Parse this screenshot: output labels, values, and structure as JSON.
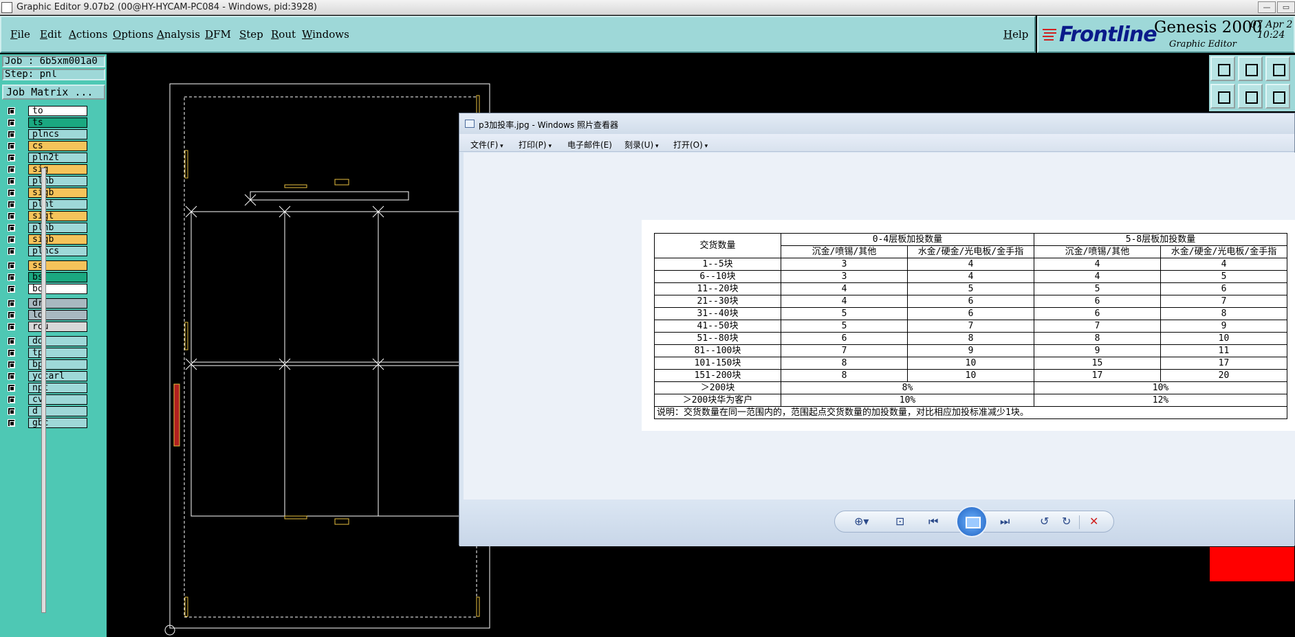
{
  "app": {
    "window_title": "Graphic Editor 9.07b2 (00@HY-HYCAM-PC084 - Windows, pid:3928)",
    "win_buttons": [
      "—",
      "▭"
    ]
  },
  "menubar": {
    "items": [
      "File",
      "Edit",
      "Actions",
      "Options",
      "Analysis",
      "DFM",
      "Step",
      "Rout",
      "Windows"
    ],
    "help": "Help"
  },
  "brand": {
    "logo": "Frontline",
    "product": "Genesis 2000",
    "subtitle": "Graphic Editor",
    "date": "07 Apr 2",
    "time": "10:24"
  },
  "job": {
    "job_label": "Job : 6b5xm001a0",
    "step_label": "Step: pnl",
    "matrix_button": "Job Matrix ..."
  },
  "layers": [
    {
      "name": "to",
      "color": "#ffffff"
    },
    {
      "name": "ts",
      "color": "#1aa880"
    },
    {
      "name": "plncs",
      "color": "#9ed8d8"
    },
    {
      "name": "cs",
      "color": "#f5c35a"
    },
    {
      "name": "pln2t",
      "color": "#9ed8d8"
    },
    {
      "name": "sig",
      "color": "#f5c35a"
    },
    {
      "name": "plnb",
      "color": "#9ed8d8"
    },
    {
      "name": "sigb",
      "color": "#f5c35a"
    },
    {
      "name": "plnt",
      "color": "#9ed8d8"
    },
    {
      "name": "sigt",
      "color": "#f5c35a"
    },
    {
      "name": "plnb",
      "color": "#9ed8d8"
    },
    {
      "name": "sigb",
      "color": "#f5c35a"
    },
    {
      "name": "plncs",
      "color": "#9ed8d8"
    },
    {
      "name": "ss",
      "color": "#f5c35a"
    },
    {
      "name": "bs",
      "color": "#1aa880"
    },
    {
      "name": "bo",
      "color": "#ffffff"
    },
    {
      "name": "dr",
      "color": "#a8b8c0"
    },
    {
      "name": "ld",
      "color": "#a8b8c0"
    },
    {
      "name": "rou",
      "color": "#d8d8d8"
    },
    {
      "name": "dd",
      "color": "#9ed8d8"
    },
    {
      "name": "tp",
      "color": "#9ed8d8"
    },
    {
      "name": "bp",
      "color": "#9ed8d8"
    },
    {
      "name": "ydcarl",
      "color": "#9ed8d8"
    },
    {
      "name": "npt",
      "color": "#9ed8d8"
    },
    {
      "name": "cv",
      "color": "#9ed8d8"
    },
    {
      "name": "d",
      "color": "#9ed8d8"
    },
    {
      "name": "gbc",
      "color": "#9ed8d8"
    }
  ],
  "viewer": {
    "title": "p3加投率.jpg - Windows 照片查看器",
    "menu": [
      "文件(F)",
      "打印(P)",
      "电子邮件(E)",
      "刻录(U)",
      "打开(O)"
    ],
    "controls": {
      "zoom": "⊕▾",
      "fit": "⊡",
      "prev": "⏮",
      "next": "⏭",
      "rotl": "↺",
      "rotr": "↻",
      "delete": "✕"
    }
  },
  "table": {
    "qty_header": "交货数量",
    "group1": "0-4层板加投数量",
    "group2": "5-8层板加投数量",
    "col_a": "沉金/喷锡/其他",
    "col_b": "水金/硬金/光电板/金手指",
    "rows": [
      [
        "1--5块",
        "3",
        "4",
        "4",
        "4"
      ],
      [
        "6--10块",
        "3",
        "4",
        "4",
        "5"
      ],
      [
        "11--20块",
        "4",
        "5",
        "5",
        "6"
      ],
      [
        "21--30块",
        "4",
        "6",
        "6",
        "7"
      ],
      [
        "31--40块",
        "5",
        "6",
        "6",
        "8"
      ],
      [
        "41--50块",
        "5",
        "7",
        "7",
        "9"
      ],
      [
        "51--80块",
        "6",
        "8",
        "8",
        "10"
      ],
      [
        "81--100块",
        "7",
        "9",
        "9",
        "11"
      ],
      [
        "101-150块",
        "8",
        "10",
        "15",
        "17"
      ],
      [
        "151-200块",
        "8",
        "10",
        "17",
        "20"
      ]
    ],
    "over200": {
      "label": "＞200块",
      "g1": "8%",
      "g2": "10%"
    },
    "over200hw": {
      "label": "＞200块华为客户",
      "g1": "10%",
      "g2": "12%"
    },
    "note": "说明：交货数量在同一范围内的，范围起点交货数量的加投数量，对比相应加投标准减少1块。"
  }
}
